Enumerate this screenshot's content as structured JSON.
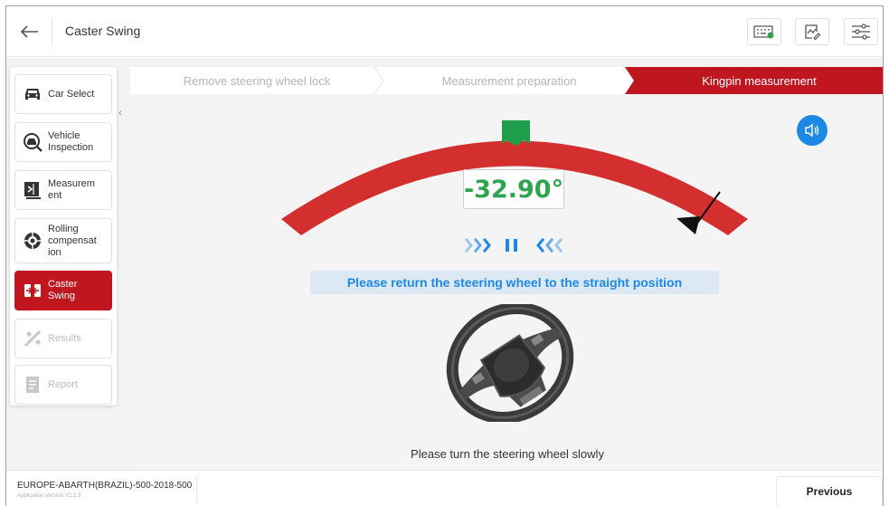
{
  "header": {
    "title": "Caster Swing"
  },
  "sidebar": {
    "items": [
      {
        "label": "Car Select",
        "icon": "car-icon",
        "state": "normal"
      },
      {
        "label": "Vehicle Inspection",
        "icon": "inspection-icon",
        "state": "normal"
      },
      {
        "label": "Measurem ent",
        "icon": "measurement-icon",
        "state": "normal"
      },
      {
        "label": "Rolling compensat ion",
        "icon": "rolling-icon",
        "state": "normal"
      },
      {
        "label": "Caster Swing",
        "icon": "caster-icon",
        "state": "active"
      },
      {
        "label": "Results",
        "icon": "results-icon",
        "state": "disabled"
      },
      {
        "label": "Report",
        "icon": "report-icon",
        "state": "disabled"
      }
    ]
  },
  "steps": [
    {
      "label": "Remove steering wheel lock",
      "active": false
    },
    {
      "label": "Measurement preparation",
      "active": false
    },
    {
      "label": "Kingpin measurement",
      "active": true
    }
  ],
  "gauge": {
    "angle": "-32.90°",
    "angle_color": "#2ea44f"
  },
  "instruction": "Please return the steering wheel to the straight position",
  "hint": "Please turn the steering wheel slowly",
  "footer": {
    "vehicle": "EUROPE-ABARTH(BRAZIL)-500-2018-500",
    "version": "Application Version V2.1.3",
    "previous_label": "Previous"
  },
  "colors": {
    "accent_red": "#c0161f",
    "gauge_red": "#d32f2f",
    "gauge_green": "#1e9e4a",
    "blue": "#1e88e5"
  }
}
